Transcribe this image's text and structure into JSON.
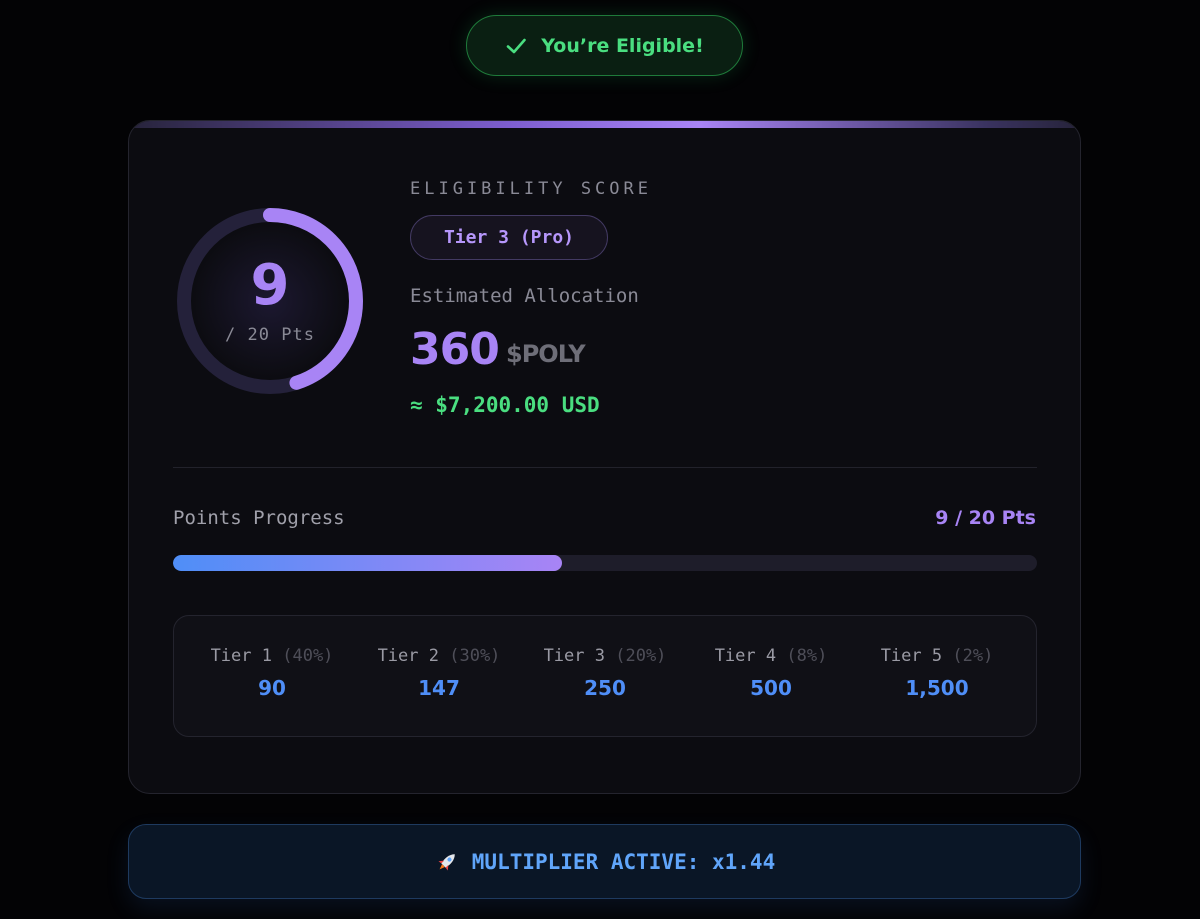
{
  "badge": {
    "label": "You’re Eligible!",
    "icon": "check-icon"
  },
  "score": {
    "value": "9",
    "max_label": "/ 20 Pts",
    "points": 9,
    "max_points": 20
  },
  "eligibility": {
    "heading": "ELIGIBILITY SCORE",
    "tier_badge": "Tier 3 (Pro)"
  },
  "allocation": {
    "label": "Estimated Allocation",
    "amount": "360",
    "token": "$POLY",
    "usd": "≈ $7,200.00 USD"
  },
  "progress": {
    "label": "Points Progress",
    "value_label": "9 / 20 Pts",
    "fraction": 0.45
  },
  "tiers": [
    {
      "name": "Tier 1",
      "pct": "(40%)",
      "value": "90"
    },
    {
      "name": "Tier 2",
      "pct": "(30%)",
      "value": "147"
    },
    {
      "name": "Tier 3",
      "pct": "(20%)",
      "value": "250"
    },
    {
      "name": "Tier 4",
      "pct": "(8%)",
      "value": "500"
    },
    {
      "name": "Tier 5",
      "pct": "(2%)",
      "value": "1,500"
    }
  ],
  "multiplier": {
    "label": "MULTIPLIER ACTIVE: x1.44",
    "icon": "rocket-icon"
  },
  "colors": {
    "accent_purple": "#a884f5",
    "success_green": "#4ade80",
    "accent_blue": "#4f8ef7",
    "multiplier_blue": "#60a5fa"
  }
}
